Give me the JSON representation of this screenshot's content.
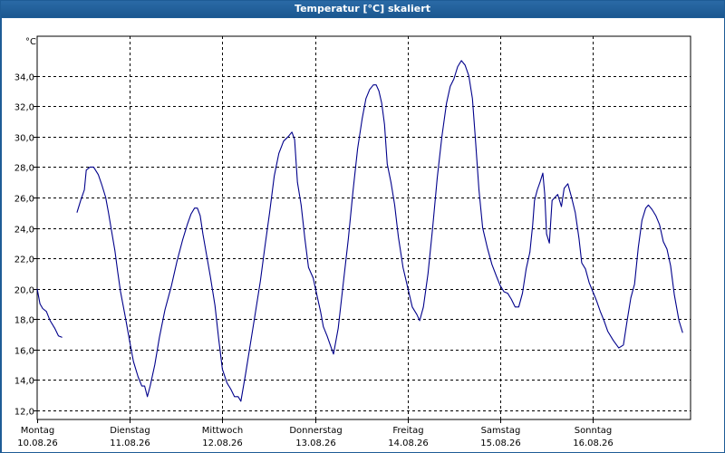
{
  "window": {
    "title": "Temperatur [°C] skaliert",
    "background": "#1e5c96"
  },
  "chart_data": {
    "type": "line",
    "title": "Temperatur [°C] skaliert",
    "ylabel": "°C",
    "ylim": [
      11.4,
      36.6
    ],
    "yticks": [
      "12,0",
      "14,0",
      "16,0",
      "18,0",
      "20,0",
      "22,0",
      "24,0",
      "26,0",
      "28,0",
      "30,0",
      "32,0",
      "34,0"
    ],
    "xticks": [
      {
        "day": "Montag",
        "date": "10.08.26"
      },
      {
        "day": "Dienstag",
        "date": "11.08.26"
      },
      {
        "day": "Mittwoch",
        "date": "12.08.26"
      },
      {
        "day": "Donnerstag",
        "date": "13.08.26"
      },
      {
        "day": "Freitag",
        "date": "14.08.26"
      },
      {
        "day": "Samstag",
        "date": "15.08.26"
      },
      {
        "day": "Sonntag",
        "date": "16.08.26"
      }
    ],
    "x_unit": "days since Montag 10.08.26 00:00",
    "grid": true,
    "line_color": "#00008b",
    "series": [
      {
        "segments": [
          [
            [
              0.0,
              20.0
            ],
            [
              0.03,
              19.0
            ],
            [
              0.06,
              18.7
            ],
            [
              0.1,
              18.5
            ],
            [
              0.14,
              17.9
            ],
            [
              0.19,
              17.4
            ],
            [
              0.23,
              16.9
            ],
            [
              0.27,
              16.8
            ]
          ],
          [
            [
              0.43,
              25.0
            ],
            [
              0.47,
              25.8
            ],
            [
              0.51,
              26.5
            ],
            [
              0.53,
              27.8
            ],
            [
              0.57,
              28.0
            ],
            [
              0.61,
              28.0
            ],
            [
              0.66,
              27.5
            ],
            [
              0.7,
              26.8
            ],
            [
              0.74,
              26.0
            ],
            [
              0.77,
              25.0
            ],
            [
              0.8,
              23.9
            ],
            [
              0.84,
              22.5
            ],
            [
              0.87,
              21.1
            ],
            [
              0.9,
              19.8
            ],
            [
              0.95,
              18.2
            ],
            [
              1.0,
              16.5
            ],
            [
              1.04,
              15.2
            ],
            [
              1.09,
              14.2
            ],
            [
              1.13,
              13.6
            ],
            [
              1.16,
              13.6
            ],
            [
              1.19,
              12.9
            ],
            [
              1.22,
              13.6
            ],
            [
              1.27,
              15.0
            ],
            [
              1.32,
              16.8
            ],
            [
              1.38,
              18.6
            ],
            [
              1.45,
              20.2
            ],
            [
              1.51,
              21.8
            ],
            [
              1.57,
              23.2
            ],
            [
              1.62,
              24.2
            ],
            [
              1.66,
              24.9
            ],
            [
              1.7,
              25.3
            ],
            [
              1.73,
              25.3
            ],
            [
              1.76,
              24.8
            ],
            [
              1.79,
              23.6
            ],
            [
              1.83,
              22.2
            ],
            [
              1.87,
              20.8
            ],
            [
              1.92,
              18.9
            ],
            [
              1.96,
              16.7
            ],
            [
              2.0,
              14.7
            ],
            [
              2.05,
              13.8
            ],
            [
              2.09,
              13.4
            ],
            [
              2.13,
              12.9
            ],
            [
              2.17,
              12.9
            ],
            [
              2.2,
              12.6
            ],
            [
              2.25,
              14.4
            ],
            [
              2.3,
              16.3
            ],
            [
              2.35,
              18.2
            ],
            [
              2.41,
              20.5
            ],
            [
              2.46,
              22.8
            ],
            [
              2.51,
              25.0
            ],
            [
              2.56,
              27.4
            ],
            [
              2.61,
              28.9
            ],
            [
              2.66,
              29.7
            ],
            [
              2.71,
              30.0
            ],
            [
              2.75,
              30.3
            ],
            [
              2.78,
              29.8
            ],
            [
              2.81,
              27.0
            ],
            [
              2.85,
              25.5
            ],
            [
              2.89,
              23.3
            ],
            [
              2.93,
              21.4
            ],
            [
              2.98,
              20.7
            ],
            [
              3.02,
              19.6
            ],
            [
              3.06,
              18.5
            ],
            [
              3.09,
              17.5
            ],
            [
              3.13,
              16.9
            ],
            [
              3.17,
              16.2
            ],
            [
              3.2,
              15.7
            ],
            [
              3.25,
              17.4
            ],
            [
              3.3,
              20.1
            ],
            [
              3.36,
              23.3
            ],
            [
              3.41,
              26.4
            ],
            [
              3.46,
              29.2
            ],
            [
              3.51,
              31.2
            ],
            [
              3.55,
              32.5
            ],
            [
              3.59,
              33.1
            ],
            [
              3.63,
              33.4
            ],
            [
              3.66,
              33.4
            ],
            [
              3.69,
              33.0
            ],
            [
              3.72,
              32.2
            ],
            [
              3.75,
              30.8
            ],
            [
              3.78,
              28.2
            ],
            [
              3.82,
              27.0
            ],
            [
              3.86,
              25.5
            ],
            [
              3.9,
              23.4
            ],
            [
              3.95,
              21.4
            ],
            [
              4.0,
              20.1
            ],
            [
              4.05,
              18.8
            ],
            [
              4.1,
              18.3
            ],
            [
              4.13,
              17.9
            ],
            [
              4.17,
              18.8
            ],
            [
              4.22,
              21.0
            ],
            [
              4.27,
              24.0
            ],
            [
              4.32,
              27.3
            ],
            [
              4.37,
              30.0
            ],
            [
              4.42,
              32.2
            ],
            [
              4.46,
              33.3
            ],
            [
              4.5,
              33.8
            ],
            [
              4.54,
              34.6
            ],
            [
              4.58,
              35.0
            ],
            [
              4.62,
              34.7
            ],
            [
              4.66,
              34.0
            ],
            [
              4.7,
              32.5
            ],
            [
              4.73,
              30.0
            ],
            [
              4.77,
              26.5
            ],
            [
              4.81,
              24.0
            ],
            [
              4.86,
              22.7
            ],
            [
              4.91,
              21.6
            ],
            [
              4.96,
              20.8
            ],
            [
              5.0,
              20.2
            ],
            [
              5.04,
              19.8
            ],
            [
              5.08,
              19.7
            ],
            [
              5.12,
              19.3
            ],
            [
              5.16,
              18.8
            ],
            [
              5.2,
              18.8
            ],
            [
              5.24,
              19.7
            ],
            [
              5.28,
              21.3
            ],
            [
              5.32,
              22.4
            ],
            [
              5.35,
              24.2
            ],
            [
              5.37,
              25.8
            ],
            [
              5.4,
              26.5
            ],
            [
              5.43,
              27.0
            ],
            [
              5.46,
              27.6
            ],
            [
              5.48,
              26.2
            ],
            [
              5.5,
              23.6
            ],
            [
              5.53,
              23.0
            ],
            [
              5.56,
              25.8
            ],
            [
              5.59,
              26.0
            ],
            [
              5.62,
              26.2
            ],
            [
              5.66,
              25.4
            ],
            [
              5.69,
              26.6
            ],
            [
              5.73,
              26.9
            ],
            [
              5.77,
              26.0
            ],
            [
              5.81,
              25.0
            ],
            [
              5.85,
              23.3
            ],
            [
              5.88,
              21.7
            ],
            [
              5.92,
              21.3
            ],
            [
              5.96,
              20.4
            ],
            [
              6.0,
              19.8
            ],
            [
              6.04,
              19.2
            ],
            [
              6.08,
              18.5
            ],
            [
              6.12,
              17.9
            ],
            [
              6.16,
              17.2
            ],
            [
              6.22,
              16.6
            ],
            [
              6.28,
              16.1
            ],
            [
              6.33,
              16.3
            ],
            [
              6.37,
              17.9
            ],
            [
              6.41,
              19.4
            ],
            [
              6.45,
              20.3
            ],
            [
              6.49,
              22.7
            ],
            [
              6.53,
              24.5
            ],
            [
              6.57,
              25.3
            ],
            [
              6.6,
              25.5
            ],
            [
              6.64,
              25.2
            ],
            [
              6.68,
              24.8
            ],
            [
              6.72,
              24.2
            ],
            [
              6.76,
              23.1
            ],
            [
              6.8,
              22.6
            ],
            [
              6.84,
              21.5
            ],
            [
              6.88,
              19.6
            ],
            [
              6.93,
              17.9
            ],
            [
              6.97,
              17.1
            ]
          ]
        ]
      }
    ]
  }
}
